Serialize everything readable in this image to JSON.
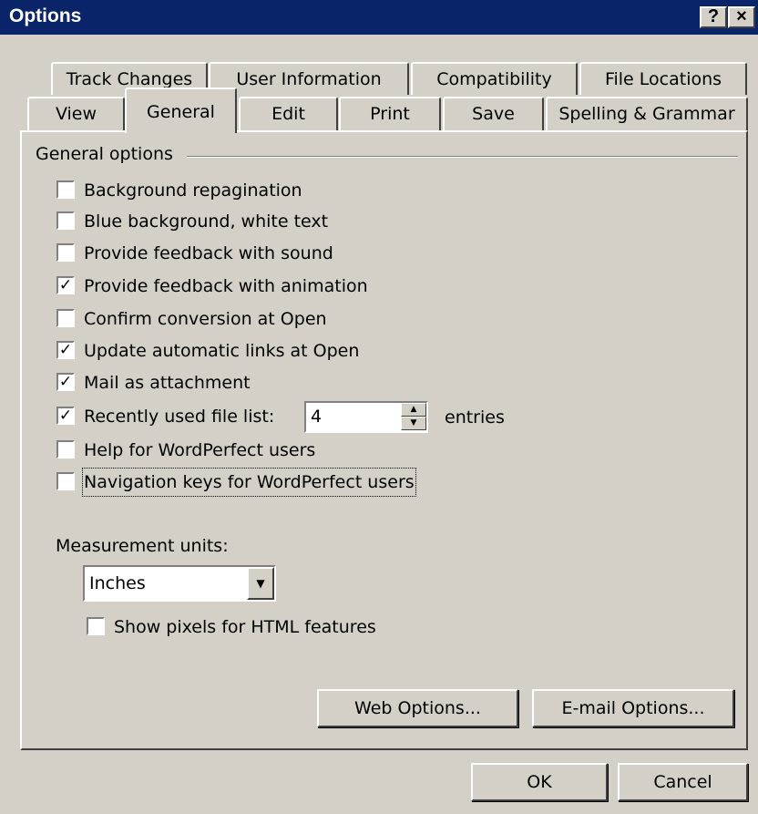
{
  "window": {
    "title": "Options",
    "help_glyph": "?",
    "close_glyph": "×"
  },
  "tabs_back": [
    "Track Changes",
    "User Information",
    "Compatibility",
    "File Locations"
  ],
  "tabs_front": [
    "View",
    "General",
    "Edit",
    "Print",
    "Save",
    "Spelling & Grammar"
  ],
  "active_tab": "General",
  "general": {
    "group_label": "General options",
    "options": [
      {
        "label": "Background repagination",
        "checked": false
      },
      {
        "label": "Blue background, white text",
        "checked": false
      },
      {
        "label": "Provide feedback with sound",
        "checked": false
      },
      {
        "label": "Provide feedback with animation",
        "checked": true
      },
      {
        "label": "Confirm conversion at Open",
        "checked": false
      },
      {
        "label": "Update automatic links at Open",
        "checked": true
      },
      {
        "label": "Mail as attachment",
        "checked": true
      },
      {
        "label": "Recently used file list:",
        "checked": true
      },
      {
        "label": "Help for WordPerfect users",
        "checked": false
      },
      {
        "label": "Navigation keys for WordPerfect users",
        "checked": false
      }
    ],
    "recent_files_count": "4",
    "entries_label": "entries",
    "measurement_label": "Measurement units:",
    "measurement_value": "Inches",
    "show_pixels_label": "Show pixels for HTML features",
    "show_pixels_checked": false,
    "web_options_label": "Web Options...",
    "email_options_label": "E-mail Options..."
  },
  "footer": {
    "ok_label": "OK",
    "cancel_label": "Cancel"
  },
  "glyphs": {
    "check": "✓",
    "up": "▲",
    "down": "▼"
  }
}
